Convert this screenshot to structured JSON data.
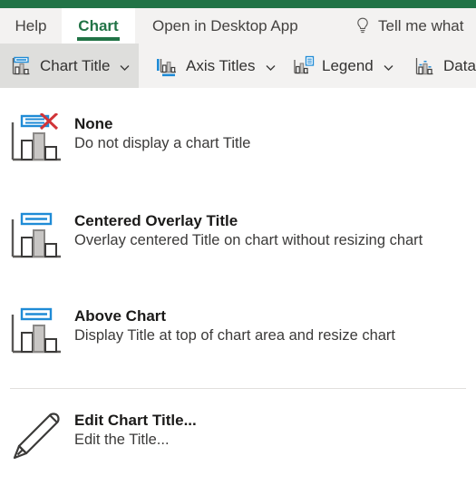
{
  "theme": {
    "brand_green": "#217346",
    "ribbon_bg": "#f3f2f1",
    "active_btn_bg": "#dededc",
    "icon_blue": "#1f8bd6",
    "icon_red": "#d13438",
    "divider": "#e1dfdd"
  },
  "tabs": [
    {
      "label": "Help",
      "name": "tab-help",
      "active": false
    },
    {
      "label": "Chart",
      "name": "tab-chart",
      "active": true
    }
  ],
  "quick_commands": {
    "open_in_desktop_app": "Open in Desktop App",
    "tell_me": "Tell me what",
    "tell_me_icon": "lightbulb-icon"
  },
  "ribbon": {
    "buttons": [
      {
        "label": "Chart Title",
        "icon": "chart-title-icon",
        "has_chevron": true,
        "active": true
      },
      {
        "label": "Axis Titles",
        "icon": "axis-titles-icon",
        "has_chevron": true,
        "active": false
      },
      {
        "label": "Legend",
        "icon": "legend-icon",
        "has_chevron": true,
        "active": false
      },
      {
        "label": "Data",
        "icon": "data-labels-icon",
        "has_chevron": false,
        "active": false
      }
    ]
  },
  "gallery": {
    "items": [
      {
        "title": "None",
        "description": "Do not display a chart Title",
        "icon": "chart-title-none-icon"
      },
      {
        "title": "Centered Overlay Title",
        "description": "Overlay centered Title on chart without resizing chart",
        "icon": "chart-title-overlay-icon"
      },
      {
        "title": "Above Chart",
        "description": "Display Title at top of chart area and resize chart",
        "icon": "chart-title-above-icon"
      },
      {
        "title": "Edit Chart Title...",
        "description": "Edit the Title...",
        "icon": "pencil-icon"
      }
    ]
  }
}
